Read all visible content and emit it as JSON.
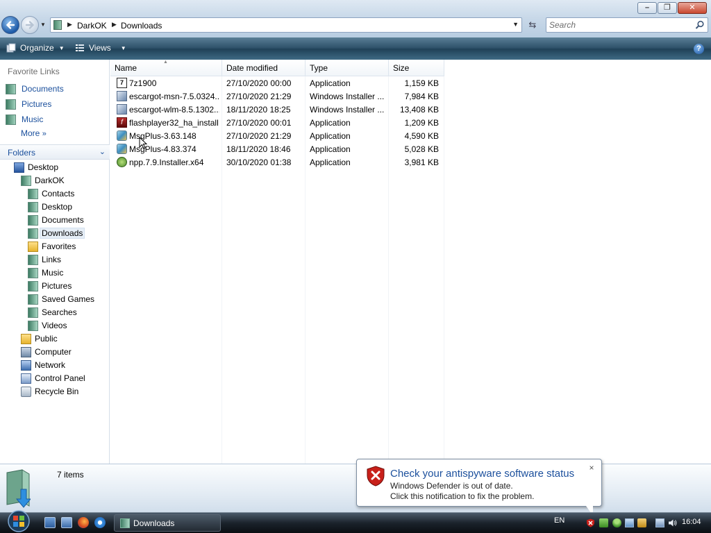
{
  "window": {
    "minimize_label": "–",
    "maximize_label": "❐",
    "close_label": "✕"
  },
  "address": {
    "crumbs": [
      "DarkOK",
      "Downloads"
    ]
  },
  "search": {
    "placeholder": "Search"
  },
  "toolbar": {
    "organize_label": "Organize",
    "views_label": "Views",
    "help_label": "?"
  },
  "nav": {
    "favorites_title": "Favorite Links",
    "favorites": [
      "Documents",
      "Pictures",
      "Music"
    ],
    "more_label": "More",
    "folders_title": "Folders",
    "tree": [
      {
        "label": "Desktop",
        "icon": "desktop-icon"
      },
      {
        "label": "DarkOK",
        "icon": "user-folder-icon"
      },
      {
        "label": "Contacts",
        "icon": "contacts-folder-icon"
      },
      {
        "label": "Desktop",
        "icon": "desktop-folder-icon"
      },
      {
        "label": "Documents",
        "icon": "documents-folder-icon"
      },
      {
        "label": "Downloads",
        "icon": "downloads-folder-icon",
        "selected": true
      },
      {
        "label": "Favorites",
        "icon": "favorites-folder-icon"
      },
      {
        "label": "Links",
        "icon": "links-folder-icon"
      },
      {
        "label": "Music",
        "icon": "music-folder-icon"
      },
      {
        "label": "Pictures",
        "icon": "pictures-folder-icon"
      },
      {
        "label": "Saved Games",
        "icon": "saved-games-folder-icon"
      },
      {
        "label": "Searches",
        "icon": "searches-folder-icon"
      },
      {
        "label": "Videos",
        "icon": "videos-folder-icon"
      },
      {
        "label": "Public",
        "icon": "public-folder-icon"
      },
      {
        "label": "Computer",
        "icon": "computer-icon"
      },
      {
        "label": "Network",
        "icon": "network-icon"
      },
      {
        "label": "Control Panel",
        "icon": "control-panel-icon"
      },
      {
        "label": "Recycle Bin",
        "icon": "recycle-bin-icon"
      }
    ]
  },
  "files": {
    "columns": [
      "Name",
      "Date modified",
      "Type",
      "Size"
    ],
    "rows": [
      {
        "name": "7z1900",
        "date": "27/10/2020 00:00",
        "type": "Application",
        "size": "1,159 KB",
        "icon": "7zip-installer-icon"
      },
      {
        "name": "escargot-msn-7.5.0324...",
        "date": "27/10/2020 21:29",
        "type": "Windows Installer ...",
        "size": "7,984 KB",
        "icon": "msi-installer-icon"
      },
      {
        "name": "escargot-wlm-8.5.1302...",
        "date": "18/11/2020 18:25",
        "type": "Windows Installer ...",
        "size": "13,408 KB",
        "icon": "msi-installer-icon"
      },
      {
        "name": "flashplayer32_ha_install",
        "date": "27/10/2020 00:01",
        "type": "Application",
        "size": "1,209 KB",
        "icon": "flash-player-icon"
      },
      {
        "name": "MsgPlus-3.63.148",
        "date": "27/10/2020 21:29",
        "type": "Application",
        "size": "4,590 KB",
        "icon": "msgplus-icon"
      },
      {
        "name": "MsgPlus-4.83.374",
        "date": "18/11/2020 18:46",
        "type": "Application",
        "size": "5,028 KB",
        "icon": "msgplus-icon"
      },
      {
        "name": "npp.7.9.Installer.x64",
        "date": "30/10/2020 01:38",
        "type": "Application",
        "size": "3,981 KB",
        "icon": "notepad-plus-plus-icon"
      }
    ]
  },
  "details": {
    "item_count": "7 items"
  },
  "notification": {
    "title": "Check your antispyware software status",
    "line1": "Windows Defender is out of date.",
    "line2": "Click this notification to fix the problem.",
    "close_label": "×"
  },
  "taskbar": {
    "task_label": "Downloads",
    "language": "EN",
    "clock": "16:04"
  },
  "colors": {
    "link_blue": "#1a4f9c",
    "command_bar": "#2d5068",
    "taskbar": "#1b232c"
  }
}
